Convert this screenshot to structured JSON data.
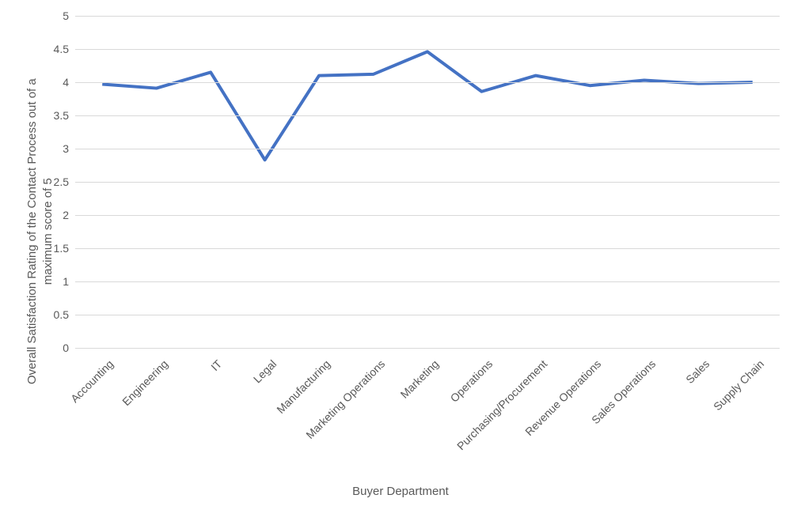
{
  "chart_data": {
    "type": "line",
    "categories": [
      "Accounting",
      "Engineering",
      "IT",
      "Legal",
      "Manufacturing",
      "Marketing Operations",
      "Marketing",
      "Operations",
      "Purchasing/Procurement",
      "Revenue Operations",
      "Sales Operations",
      "Sales",
      "Supply Chain"
    ],
    "values": [
      3.97,
      3.91,
      4.15,
      2.83,
      4.1,
      4.12,
      4.46,
      3.86,
      4.1,
      3.95,
      4.03,
      3.98,
      4.0
    ],
    "title": "",
    "xlabel": "Buyer Department",
    "ylabel": "Overall Satisfaction Rating of the Contact Process out of a maximum score of 5",
    "ylim": [
      0,
      5
    ],
    "y_ticks": [
      0,
      0.5,
      1,
      1.5,
      2,
      2.5,
      3,
      3.5,
      4,
      4.5,
      5
    ],
    "line_color": "#4472C4"
  }
}
